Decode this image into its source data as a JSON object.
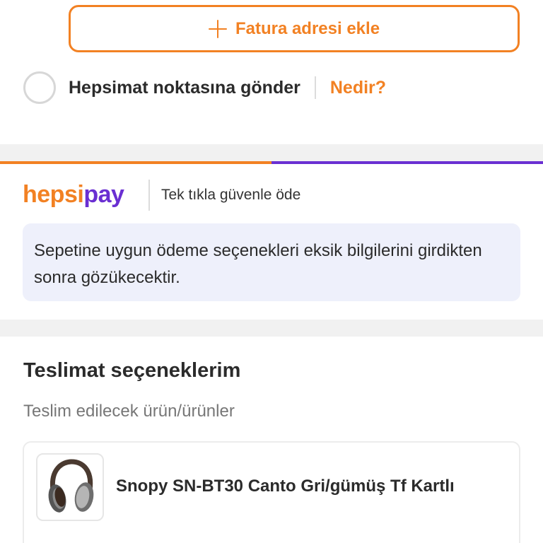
{
  "billing": {
    "add_button_label": "Fatura adresi ekle",
    "add_icon": "plus-icon"
  },
  "hepsimat": {
    "label": "Hepsimat noktasına gönder",
    "link": "Nedir?",
    "selected": false
  },
  "hepsipay": {
    "logo_part1": "hepsi",
    "logo_part2": "pay",
    "tagline": "Tek tıkla güvenle öde",
    "info": "Sepetine uygun ödeme seçenekleri eksik bilgilerini girdikten sonra gözükecektir.",
    "colors": {
      "orange": "#f28123",
      "purple": "#6a2fd2"
    }
  },
  "delivery": {
    "title": "Teslimat seçeneklerim",
    "subtitle": "Teslim edilecek ürün/ürünler",
    "products": [
      {
        "name": "Snopy SN-BT30 Canto Gri/gümüş Tf Kartlı",
        "image_icon": "headphones-icon"
      }
    ]
  }
}
